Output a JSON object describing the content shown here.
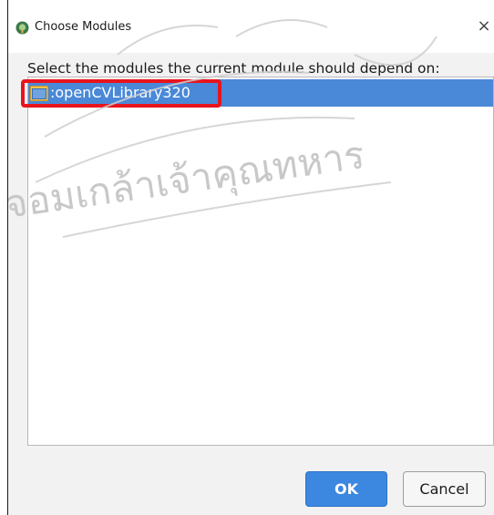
{
  "dialog": {
    "title": "Choose Modules",
    "close_symbol": "×",
    "prompt": "Select the modules the current module should depend on:",
    "title_icon": "android-studio-icon"
  },
  "modules": [
    {
      "name": ":openCVLibrary320",
      "icon": "module-folder-icon",
      "selected": true
    }
  ],
  "buttons": {
    "ok_label": "OK",
    "cancel_label": "Cancel"
  },
  "watermark": {
    "text": "จอมเกล้าเจ้าคุณทหาร"
  },
  "colors": {
    "selection": "#4a88d8",
    "highlight_border": "#e8141c",
    "ok_button": "#3c87e0"
  }
}
